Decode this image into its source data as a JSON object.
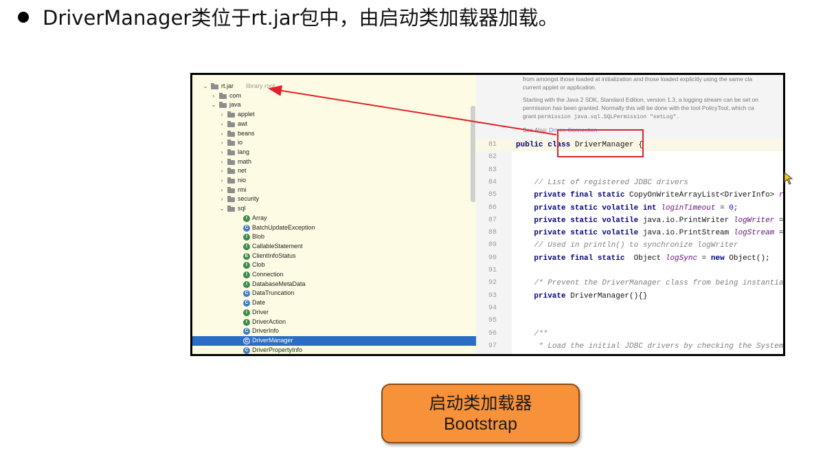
{
  "heading": "DriverManager类位于rt.jar包中，由启动类加载器加载。",
  "tree": {
    "rows": [
      {
        "text": "rt.jar",
        "note": "library root",
        "kind": "jar",
        "arrow": "⌄",
        "indent": 0
      },
      {
        "text": "com",
        "kind": "folder",
        "arrow": "›",
        "indent": 1
      },
      {
        "text": "java",
        "kind": "folder",
        "arrow": "⌄",
        "indent": 1
      },
      {
        "text": "applet",
        "kind": "folder",
        "arrow": "›",
        "indent": 2
      },
      {
        "text": "awt",
        "kind": "folder",
        "arrow": "›",
        "indent": 2
      },
      {
        "text": "beans",
        "kind": "folder",
        "arrow": "›",
        "indent": 2
      },
      {
        "text": "io",
        "kind": "folder",
        "arrow": "›",
        "indent": 2
      },
      {
        "text": "lang",
        "kind": "folder",
        "arrow": "›",
        "indent": 2
      },
      {
        "text": "math",
        "kind": "folder",
        "arrow": "›",
        "indent": 2
      },
      {
        "text": "net",
        "kind": "folder",
        "arrow": "›",
        "indent": 2
      },
      {
        "text": "nio",
        "kind": "folder",
        "arrow": "›",
        "indent": 2
      },
      {
        "text": "rmi",
        "kind": "folder",
        "arrow": "›",
        "indent": 2
      },
      {
        "text": "security",
        "kind": "folder",
        "arrow": "›",
        "indent": 2
      },
      {
        "text": "sql",
        "kind": "folder",
        "arrow": "⌄",
        "indent": 2
      },
      {
        "text": "Array",
        "kind": "interface",
        "indent": 3
      },
      {
        "text": "BatchUpdateException",
        "kind": "class",
        "indent": 3
      },
      {
        "text": "Blob",
        "kind": "interface",
        "indent": 3
      },
      {
        "text": "CallableStatement",
        "kind": "interface",
        "indent": 3
      },
      {
        "text": "ClientInfoStatus",
        "kind": "enum",
        "indent": 3
      },
      {
        "text": "Clob",
        "kind": "interface",
        "indent": 3
      },
      {
        "text": "Connection",
        "kind": "interface",
        "indent": 3
      },
      {
        "text": "DatabaseMetaData",
        "kind": "interface",
        "indent": 3
      },
      {
        "text": "DataTruncation",
        "kind": "class",
        "indent": 3
      },
      {
        "text": "Date",
        "kind": "class",
        "indent": 3
      },
      {
        "text": "Driver",
        "kind": "interface",
        "indent": 3
      },
      {
        "text": "DriverAction",
        "kind": "interface",
        "indent": 3
      },
      {
        "text": "DriverInfo",
        "kind": "class",
        "indent": 3
      },
      {
        "text": "DriverManager",
        "kind": "class",
        "indent": 3,
        "selected": true
      },
      {
        "text": "DriverPropertyInfo",
        "kind": "class",
        "indent": 3
      }
    ]
  },
  "doc": {
    "line1": "from amongst those loaded at initialization and those loaded explicitly using the same cla",
    "line2": "current applet or application.",
    "line3": "Starting with the Java 2 SDK, Standard Edition, version 1.3, a logging stream can be set on",
    "line4": "permission has been granted. Normally this will be done with the tool PolicyTool, which ca",
    "line5_prefix": "grant",
    "line5_code": "permission java.sql.SQLPermission \"setLog\".",
    "see_also_label": "See Also:",
    "see_also_links": "Driver, Connection"
  },
  "code": {
    "lines": [
      {
        "n": "81",
        "hl": true,
        "parts": [
          [
            "kw",
            "public "
          ],
          [
            "kw",
            "class "
          ],
          [
            "",
            "DriverManager {"
          ]
        ]
      },
      {
        "n": "82",
        "parts": []
      },
      {
        "n": "83",
        "parts": []
      },
      {
        "n": "84",
        "parts": [
          [
            "",
            "    "
          ],
          [
            "cm",
            "// List of registered JDBC drivers"
          ]
        ]
      },
      {
        "n": "85",
        "parts": [
          [
            "",
            "    "
          ],
          [
            "kw",
            "private final static "
          ],
          [
            "",
            "CopyOnWriteArrayList<DriverInfo> "
          ],
          [
            "fld",
            "r"
          ]
        ]
      },
      {
        "n": "86",
        "parts": [
          [
            "",
            "    "
          ],
          [
            "kw",
            "private static volatile int "
          ],
          [
            "fld",
            "loginTimeout"
          ],
          [
            "",
            " = "
          ],
          [
            "num",
            "0"
          ],
          [
            "",
            ";"
          ]
        ]
      },
      {
        "n": "87",
        "parts": [
          [
            "",
            "    "
          ],
          [
            "kw",
            "private static volatile "
          ],
          [
            "",
            "java.io.PrintWriter "
          ],
          [
            "fld",
            "logWriter"
          ],
          [
            "",
            " ="
          ]
        ]
      },
      {
        "n": "88",
        "parts": [
          [
            "",
            "    "
          ],
          [
            "kw",
            "private static volatile "
          ],
          [
            "",
            "java.io.PrintStream "
          ],
          [
            "fld",
            "logStream"
          ],
          [
            "",
            " ="
          ]
        ]
      },
      {
        "n": "89",
        "parts": [
          [
            "",
            "    "
          ],
          [
            "cm",
            "// Used in println() to synchronize logWriter"
          ]
        ]
      },
      {
        "n": "90",
        "parts": [
          [
            "",
            "    "
          ],
          [
            "kw",
            "private final static  "
          ],
          [
            "",
            "Object "
          ],
          [
            "fld",
            "logSync"
          ],
          [
            "",
            " = "
          ],
          [
            "kw",
            "new "
          ],
          [
            "",
            "Object();"
          ]
        ]
      },
      {
        "n": "91",
        "parts": []
      },
      {
        "n": "92",
        "parts": [
          [
            "",
            "    "
          ],
          [
            "cm",
            "/* Prevent the DriverManager class from being instantia"
          ]
        ]
      },
      {
        "n": "93",
        "parts": [
          [
            "",
            "    "
          ],
          [
            "kw",
            "private "
          ],
          [
            "",
            "DriverManager(){}"
          ]
        ]
      },
      {
        "n": "94",
        "parts": []
      },
      {
        "n": "95",
        "parts": []
      },
      {
        "n": "96",
        "parts": [
          [
            "",
            "    "
          ],
          [
            "cm",
            "/**"
          ]
        ]
      },
      {
        "n": "97",
        "parts": [
          [
            "",
            "     "
          ],
          [
            "cm",
            "* Load the initial JDBC drivers by checking the System"
          ]
        ]
      }
    ]
  },
  "bootstrap": {
    "line1": "启动类加载器",
    "line2": "Bootstrap"
  },
  "colors": {
    "accent_red": "#e0202a",
    "box_orange": "#f7923a",
    "selection_blue": "#2a6dc4"
  }
}
